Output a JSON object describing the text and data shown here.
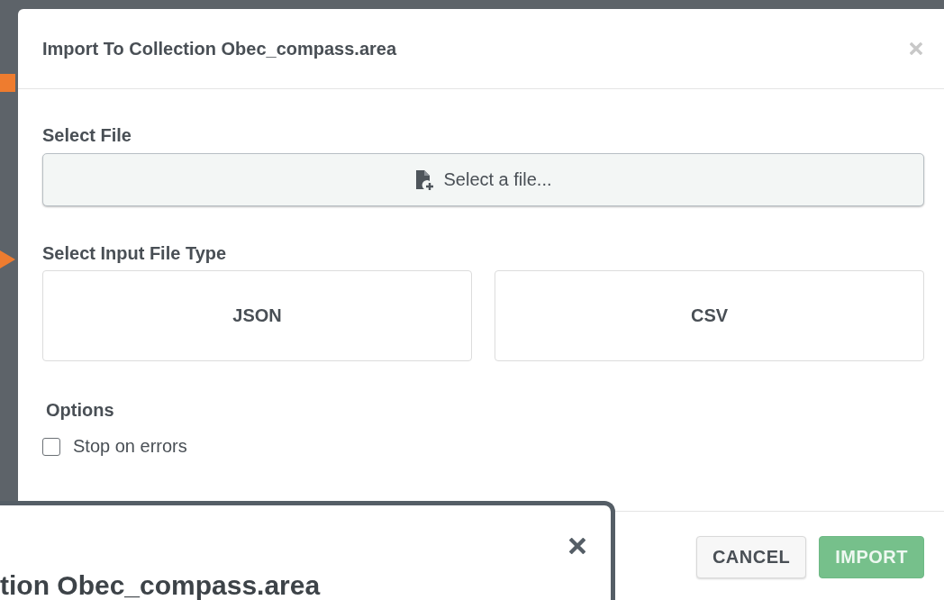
{
  "dialog": {
    "title": "Import To Collection Obec_compass.area",
    "select_file": {
      "label": "Select File",
      "button": "Select a file..."
    },
    "file_type": {
      "label": "Select Input File Type",
      "options": [
        {
          "label": "JSON",
          "selected": false
        },
        {
          "label": "CSV",
          "selected": false
        }
      ]
    },
    "options": {
      "label": "Options",
      "items": [
        {
          "label": "Stop on errors",
          "checked": false
        }
      ]
    },
    "buttons": [
      {
        "label": "CANCEL",
        "kind": "secondary",
        "disabled": false
      },
      {
        "label": "IMPORT",
        "kind": "primary",
        "disabled": true
      }
    ]
  },
  "back_dialog": {
    "title": "tion Obec_compass.area"
  }
}
